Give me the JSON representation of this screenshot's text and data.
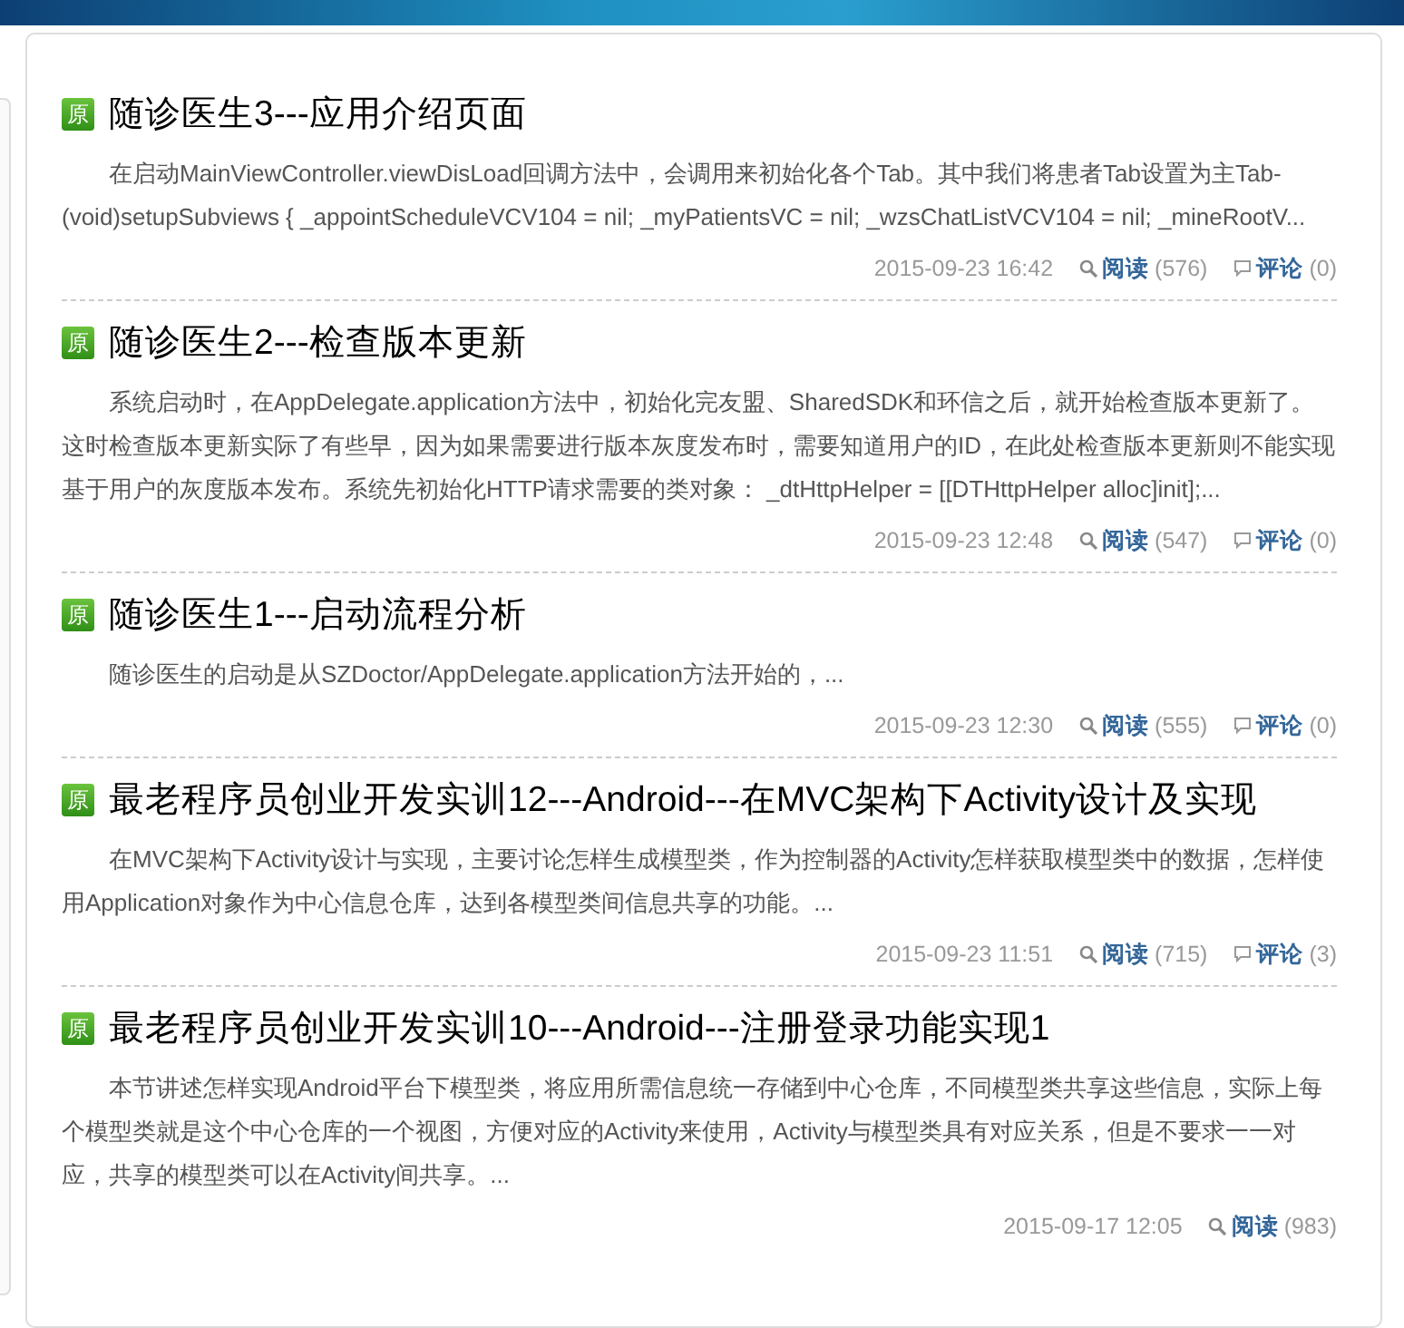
{
  "posts": [
    {
      "badge": "原",
      "title": "随诊医生3---应用介绍页面",
      "summary": "在启动MainViewController.viewDisLoad回调方法中，会调用来初始化各个Tab。其中我们将患者Tab设置为主Tab- (void)setupSubviews { _appointScheduleVCV104 = nil; _myPatientsVC = nil; _wzsChatListVCV104 = nil; _mineRootV...",
      "date": "2015-09-23 16:42",
      "read": {
        "label": "阅读",
        "count": "(576)"
      },
      "comments": {
        "label": "评论",
        "count": "(0)"
      }
    },
    {
      "badge": "原",
      "title": "随诊医生2---检查版本更新",
      "summary": "系统启动时，在AppDelegate.application方法中，初始化完友盟、SharedSDK和环信之后，就开始检查版本更新了。这时检查版本更新实际了有些早，因为如果需要进行版本灰度发布时，需要知道用户的ID，在此处检查版本更新则不能实现基于用户的灰度版本发布。系统先初始化HTTP请求需要的类对象： _dtHttpHelper = [[DTHttpHelper alloc]init];...",
      "date": "2015-09-23 12:48",
      "read": {
        "label": "阅读",
        "count": "(547)"
      },
      "comments": {
        "label": "评论",
        "count": "(0)"
      }
    },
    {
      "badge": "原",
      "title": "随诊医生1---启动流程分析",
      "summary": "随诊医生的启动是从SZDoctor/AppDelegate.application方法开始的，...",
      "date": "2015-09-23 12:30",
      "read": {
        "label": "阅读",
        "count": "(555)"
      },
      "comments": {
        "label": "评论",
        "count": "(0)"
      }
    },
    {
      "badge": "原",
      "title": "最老程序员创业开发实训12---Android---在MVC架构下Activity设计及实现",
      "summary": "在MVC架构下Activity设计与实现，主要讨论怎样生成模型类，作为控制器的Activity怎样获取模型类中的数据，怎样使用Application对象作为中心信息仓库，达到各模型类间信息共享的功能。...",
      "date": "2015-09-23 11:51",
      "read": {
        "label": "阅读",
        "count": "(715)"
      },
      "comments": {
        "label": "评论",
        "count": "(3)"
      }
    },
    {
      "badge": "原",
      "title": "最老程序员创业开发实训10---Android---注册登录功能实现1",
      "summary": "本节讲述怎样实现Android平台下模型类，将应用所需信息统一存储到中心仓库，不同模型类共享这些信息，实际上每个模型类就是这个中心仓库的一个视图，方便对应的Activity来使用，Activity与模型类具有对应关系，但是不要求一一对应，共享的模型类可以在Activity间共享。...",
      "date": "2015-09-17 12:05",
      "read": {
        "label": "阅读",
        "count": "(983)"
      }
    }
  ]
}
